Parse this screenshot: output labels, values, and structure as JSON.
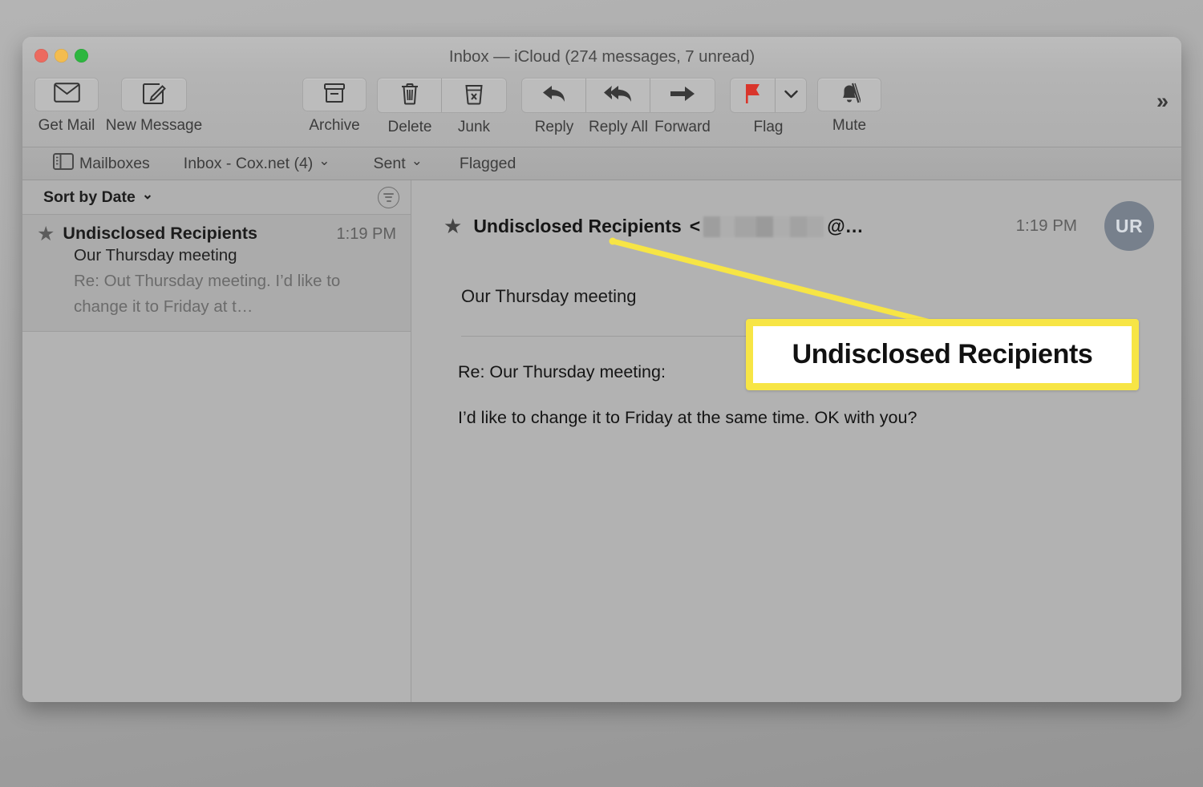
{
  "window": {
    "title": "Inbox — iCloud (274 messages, 7 unread)",
    "traffic_lights": [
      {
        "name": "close",
        "color": "#ec6a5f"
      },
      {
        "name": "minimize",
        "color": "#f3bc4f"
      },
      {
        "name": "zoom",
        "color": "#2db63f"
      }
    ]
  },
  "toolbar": {
    "get_mail": "Get Mail",
    "new_message": "New Message",
    "archive": "Archive",
    "delete": "Delete",
    "junk": "Junk",
    "reply": "Reply",
    "reply_all": "Reply All",
    "forward": "Forward",
    "flag": "Flag",
    "mute": "Mute",
    "overflow": "»",
    "flag_color": "#d9352b",
    "icons": {
      "get_mail": "envelope-icon",
      "new_message": "compose-icon",
      "archive": "archive-box-icon",
      "delete": "trash-icon",
      "junk": "junk-bin-icon",
      "reply": "reply-arrow-icon",
      "reply_all": "reply-all-arrow-icon",
      "forward": "forward-arrow-icon",
      "flag": "flag-icon",
      "flag_menu": "chevron-down-icon",
      "mute": "bell-slash-icon"
    }
  },
  "favorites": {
    "mailboxes": "Mailboxes",
    "inbox": "Inbox - Cox.net (4)",
    "sent": "Sent",
    "flagged": "Flagged",
    "chevron": "⌄",
    "sidebar_icon": "sidebar-toggle-icon"
  },
  "message_list": {
    "sort_label": "Sort by Date",
    "sort_chevron": "⌄",
    "filter_icon": "filter-icon",
    "messages": [
      {
        "starred": true,
        "star_glyph": "★",
        "sender": "Undisclosed Recipients",
        "time": "1:19 PM",
        "subject": "Our Thursday meeting",
        "preview": "Re: Out Thursday meeting. I’d like to change it to Friday at t…"
      }
    ]
  },
  "reading_pane": {
    "star_glyph": "★",
    "sender": "Undisclosed Recipients",
    "address_open": "<",
    "address_blurred": true,
    "address_tail": "@…",
    "time": "1:19 PM",
    "avatar_initials": "UR",
    "subject": "Our Thursday meeting",
    "body_lines": [
      "Re: Our Thursday meeting:",
      "I’d like to change it to Friday at the same time. OK with you?"
    ]
  },
  "annotation": {
    "callout_text": "Undisclosed Recipients",
    "highlight_color": "#f7e545",
    "callout_bg": "#ffffff",
    "pointer_from": [
      762,
      300
    ],
    "pointer_to": [
      1150,
      400
    ]
  }
}
